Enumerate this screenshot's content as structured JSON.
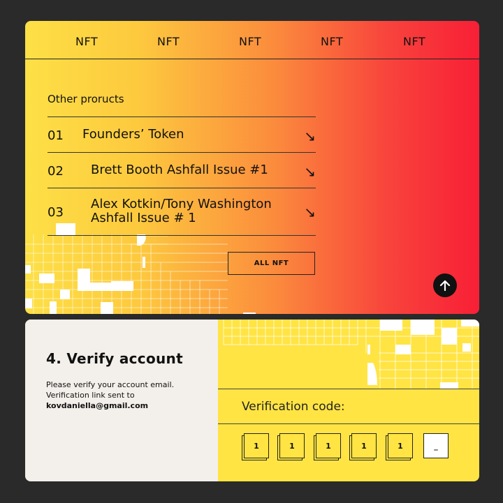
{
  "nav": {
    "items": [
      "NFT",
      "NFT",
      "NFT",
      "NFT",
      "NFT"
    ]
  },
  "products": {
    "title": "Other proructs",
    "items": [
      {
        "number": "01",
        "name_line1": "Founders’ Token",
        "name_line2": "",
        "arrow": "↘"
      },
      {
        "number": "02",
        "name_line1": "Brett Booth Ashfall Issue #1",
        "name_line2": "",
        "arrow": "↘"
      },
      {
        "number": "03",
        "name_line1": "Alex Kotkin/Tony Washington",
        "name_line2": "Ashfall Issue # 1",
        "arrow": "↘"
      }
    ],
    "all_button": "ALL NFT"
  },
  "scroll_top_icon": "arrow-up-icon",
  "verify": {
    "title": "4. Verify account",
    "text_line1": "Please verify your account email.",
    "text_line2": "Verification link sent to",
    "email": "kovdaniella@gmail.com",
    "code_label": "Verification code:",
    "code_digits": [
      "1",
      "1",
      "1",
      "1",
      "1",
      "_"
    ]
  },
  "colors": {
    "gradient_start": "#fde046",
    "gradient_end": "#f81f36",
    "verify_panel": "#f3efea",
    "yellow": "#ffe443",
    "background": "#2a2a2a"
  }
}
